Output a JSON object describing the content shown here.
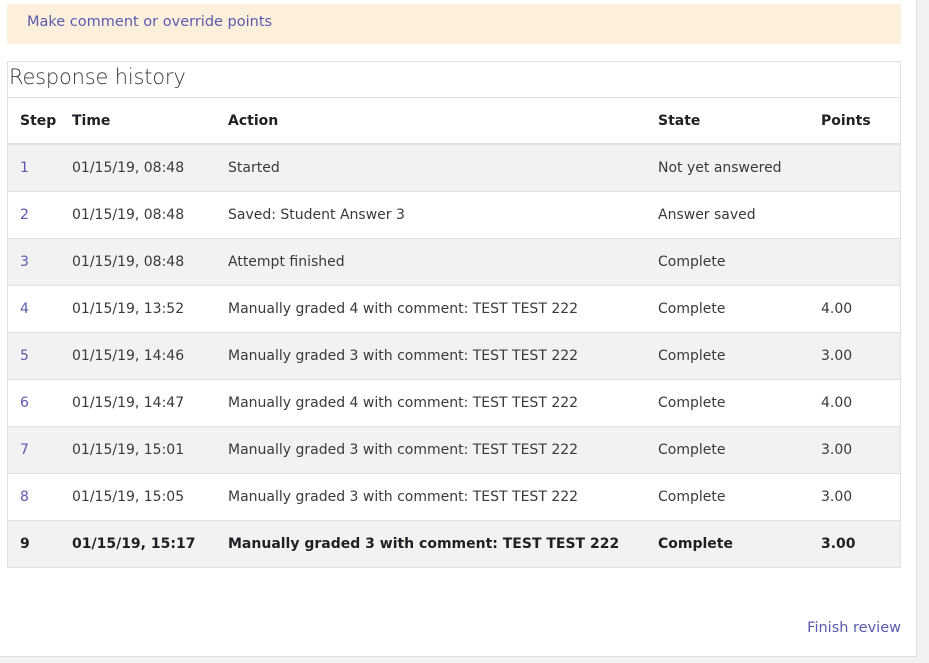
{
  "comment_link": "Make comment or override points",
  "history": {
    "title": "Response history",
    "columns": {
      "step": "Step",
      "time": "Time",
      "action": "Action",
      "state": "State",
      "points": "Points"
    },
    "rows": [
      {
        "step": "1",
        "time": "01/15/19, 08:48",
        "action": "Started",
        "state": "Not yet answered",
        "points": ""
      },
      {
        "step": "2",
        "time": "01/15/19, 08:48",
        "action": "Saved: Student Answer 3",
        "state": "Answer saved",
        "points": ""
      },
      {
        "step": "3",
        "time": "01/15/19, 08:48",
        "action": "Attempt finished",
        "state": "Complete",
        "points": ""
      },
      {
        "step": "4",
        "time": "01/15/19, 13:52",
        "action": "Manually graded 4 with comment: TEST TEST 222",
        "state": "Complete",
        "points": "4.00"
      },
      {
        "step": "5",
        "time": "01/15/19, 14:46",
        "action": "Manually graded 3 with comment: TEST TEST 222",
        "state": "Complete",
        "points": "3.00"
      },
      {
        "step": "6",
        "time": "01/15/19, 14:47",
        "action": "Manually graded 4 with comment: TEST TEST 222",
        "state": "Complete",
        "points": "4.00"
      },
      {
        "step": "7",
        "time": "01/15/19, 15:01",
        "action": "Manually graded 3 with comment: TEST TEST 222",
        "state": "Complete",
        "points": "3.00"
      },
      {
        "step": "8",
        "time": "01/15/19, 15:05",
        "action": "Manually graded 3 with comment: TEST TEST 222",
        "state": "Complete",
        "points": "3.00"
      },
      {
        "step": "9",
        "time": "01/15/19, 15:17",
        "action": "Manually graded 3 with comment: TEST TEST 222",
        "state": "Complete",
        "points": "3.00"
      }
    ]
  },
  "finish_link": "Finish review",
  "colors": {
    "link": "#5a5ab0",
    "comment_bg": "#fcefdc",
    "row_stripe": "#f2f2f2"
  }
}
